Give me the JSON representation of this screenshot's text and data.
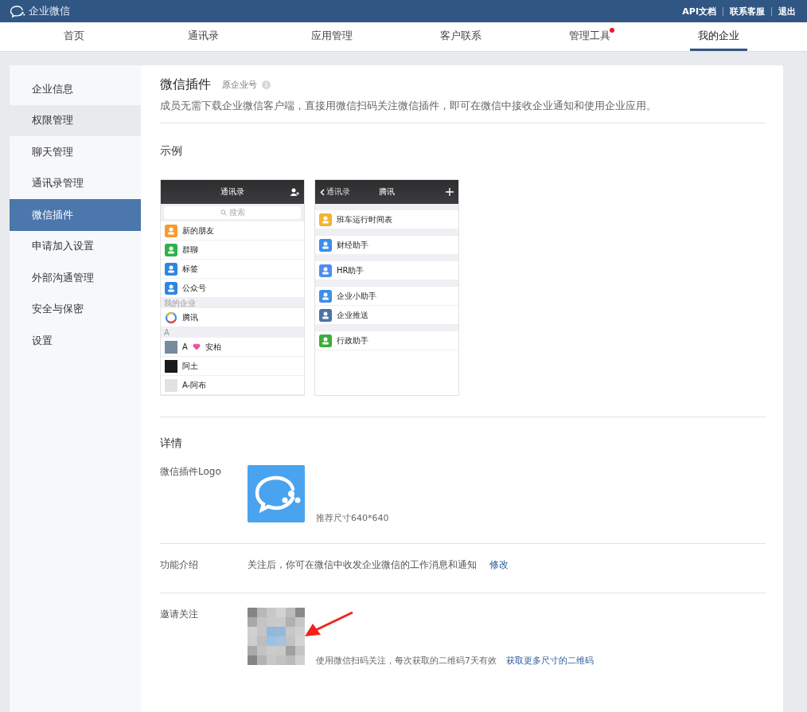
{
  "app": {
    "logo_text": "企业微信",
    "links": [
      "API文档",
      "联系客服",
      "退出"
    ]
  },
  "nav": [
    {
      "label": "首页",
      "selected": false,
      "badge": false
    },
    {
      "label": "通讯录",
      "selected": false,
      "badge": false
    },
    {
      "label": "应用管理",
      "selected": false,
      "badge": false
    },
    {
      "label": "客户联系",
      "selected": false,
      "badge": false
    },
    {
      "label": "管理工具",
      "selected": false,
      "badge": true
    },
    {
      "label": "我的企业",
      "selected": true,
      "badge": false
    }
  ],
  "sidebar": [
    {
      "label": "企业信息",
      "selected": false,
      "hovered": false
    },
    {
      "label": "权限管理",
      "selected": false,
      "hovered": true
    },
    {
      "label": "聊天管理",
      "selected": false,
      "hovered": false
    },
    {
      "label": "通讯录管理",
      "selected": false,
      "hovered": false
    },
    {
      "label": "微信插件",
      "selected": true,
      "hovered": false
    },
    {
      "label": "申请加入设置",
      "selected": false,
      "hovered": false
    },
    {
      "label": "外部沟通管理",
      "selected": false,
      "hovered": false
    },
    {
      "label": "安全与保密",
      "selected": false,
      "hovered": false
    },
    {
      "label": "设置",
      "selected": false,
      "hovered": false
    }
  ],
  "plugin": {
    "title": "微信插件",
    "subtitle": "原企业号",
    "description": "成员无需下载企业微信客户端，直接用微信扫码关注微信插件，即可在微信中接收企业通知和使用企业应用。"
  },
  "example": {
    "heading": "示例",
    "phones": [
      {
        "title": "通讯录",
        "search_placeholder": "搜索",
        "items": [
          {
            "kind": "row",
            "label": "新的朋友",
            "color": "#f79a2f"
          },
          {
            "kind": "row",
            "label": "群聊",
            "color": "#2fb24a"
          },
          {
            "kind": "row",
            "label": "标签",
            "color": "#2f86e0"
          },
          {
            "kind": "row",
            "label": "公众号",
            "color": "#2f86e0"
          },
          {
            "kind": "section",
            "label": "我的企业"
          },
          {
            "kind": "org",
            "label": "腾讯"
          },
          {
            "kind": "section",
            "label": "A"
          },
          {
            "kind": "contact",
            "label": "A",
            "suffix": "安柏"
          },
          {
            "kind": "contact",
            "label": "阿土"
          },
          {
            "kind": "contact",
            "label": "A-阿布"
          }
        ]
      },
      {
        "title": "腾讯",
        "back": "通讯录",
        "items": [
          {
            "kind": "gap"
          },
          {
            "kind": "row",
            "label": "班车运行时间表",
            "color": "#f5b331"
          },
          {
            "kind": "gap"
          },
          {
            "kind": "row",
            "label": "财经助手",
            "color": "#3a8ef0"
          },
          {
            "kind": "gap"
          },
          {
            "kind": "row",
            "label": "HR助手",
            "color": "#4f8cf2"
          },
          {
            "kind": "gap"
          },
          {
            "kind": "row",
            "label": "企业小助手",
            "color": "#3f8fe6"
          },
          {
            "kind": "row",
            "label": "企业推送",
            "color": "#4d73a8"
          },
          {
            "kind": "gap"
          },
          {
            "kind": "row",
            "label": "行政助手",
            "color": "#3eab3a"
          }
        ]
      }
    ]
  },
  "details": {
    "heading": "详情",
    "rows": [
      {
        "kind": "logo",
        "label": "微信插件Logo",
        "hint": "推荐尺寸640*640"
      },
      {
        "kind": "text",
        "label": "功能介绍",
        "value": "关注后，你可在微信中收发企业微信的工作消息和通知",
        "action": "修改"
      },
      {
        "kind": "qr",
        "label": "邀请关注",
        "hint": "使用微信扫码关注，每次获取的二维码7天有效",
        "link": "获取更多尺寸的二维码"
      }
    ]
  }
}
